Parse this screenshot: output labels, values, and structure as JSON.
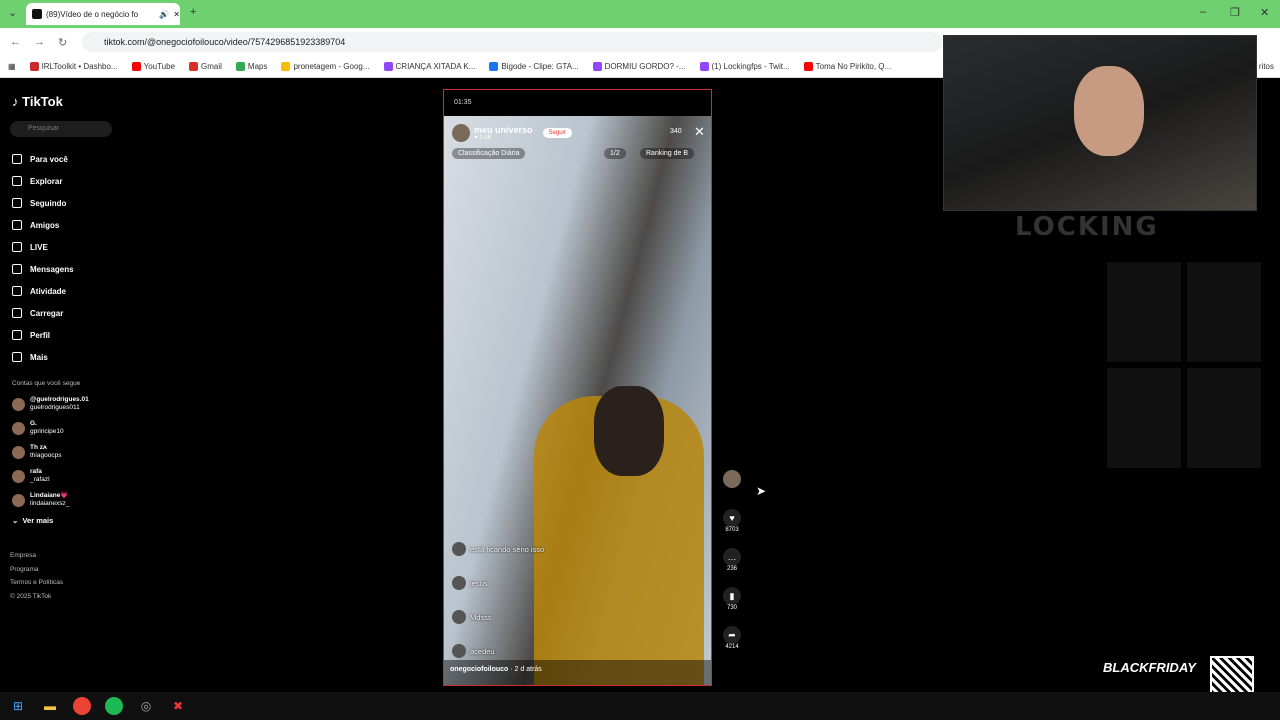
{
  "browser": {
    "tab_title": "(89)Vídeo de o negócio fo",
    "url": "tiktok.com/@onegociofoilouco/video/7574296851923389704",
    "bookmarks": [
      {
        "label": "IRLToolkit • Dashbo...",
        "color": "#c92a2a"
      },
      {
        "label": "YouTube",
        "color": "#ff0000"
      },
      {
        "label": "Gmail",
        "color": "#d93025"
      },
      {
        "label": "Maps",
        "color": "#34a853"
      },
      {
        "label": "pronetagem - Goog...",
        "color": "#fbbc05"
      },
      {
        "label": "CRIANÇA XITADA K...",
        "color": "#9146ff"
      },
      {
        "label": "Bigode - Clipe: GTA...",
        "color": "#1877f2"
      },
      {
        "label": "DORMIU GORDO? -...",
        "color": "#9146ff"
      },
      {
        "label": "(1) Lockingfps - Twit...",
        "color": "#9146ff"
      },
      {
        "label": "Toma No Pirikito, Q...",
        "color": "#ff0000"
      }
    ],
    "bookmarks_trailing": "ritos"
  },
  "sidebar": {
    "logo": "TikTok",
    "search_placeholder": "Pesquisar",
    "nav": [
      {
        "label": "Para você",
        "icon": "home-icon"
      },
      {
        "label": "Explorar",
        "icon": "compass-icon"
      },
      {
        "label": "Seguindo",
        "icon": "following-icon"
      },
      {
        "label": "Amigos",
        "icon": "friends-icon"
      },
      {
        "label": "LIVE",
        "icon": "live-icon"
      },
      {
        "label": "Mensagens",
        "icon": "inbox-icon"
      },
      {
        "label": "Atividade",
        "icon": "activity-icon"
      },
      {
        "label": "Carregar",
        "icon": "upload-icon"
      },
      {
        "label": "Perfil",
        "icon": "profile-icon"
      },
      {
        "label": "Mais",
        "icon": "more-icon"
      }
    ],
    "following_title": "Contas que você segue",
    "following": [
      {
        "name": "@guelrodrigues.01",
        "handle": "guelrodrigues011"
      },
      {
        "name": "G.",
        "handle": "gprincipe10"
      },
      {
        "name": "Th ᴢᴀ",
        "handle": "thiagoocps"
      },
      {
        "name": "rafa",
        "handle": "_rafazl"
      },
      {
        "name": "Lindaiane💗",
        "handle": "lindaianexsz_"
      }
    ],
    "see_more": "Ver mais",
    "footer": [
      "Empresa",
      "Programa",
      "Termos e Políticas",
      "© 2025 TikTok"
    ]
  },
  "phone": {
    "time": "01:35",
    "host_name": "meu universo",
    "host_likes": "2.0K",
    "follow": "Seguir",
    "viewers": "340",
    "daily_rank": "Classificação Diária",
    "page": "1/2",
    "ranking": "Ranking de B",
    "chat": [
      {
        "text": "está ficando sério isso"
      },
      {
        "text": "jesus"
      },
      {
        "text": "Mdsss"
      },
      {
        "text": "acedeu"
      }
    ],
    "uploader": "onegociofoilouco",
    "posted": "· 2 d atrás"
  },
  "actions": {
    "likes": "8703",
    "comments": "236",
    "saves": "730",
    "shares": "4214"
  },
  "overlay": {
    "brand": "LOCKING",
    "promo": "BLACKFRIDAY"
  }
}
